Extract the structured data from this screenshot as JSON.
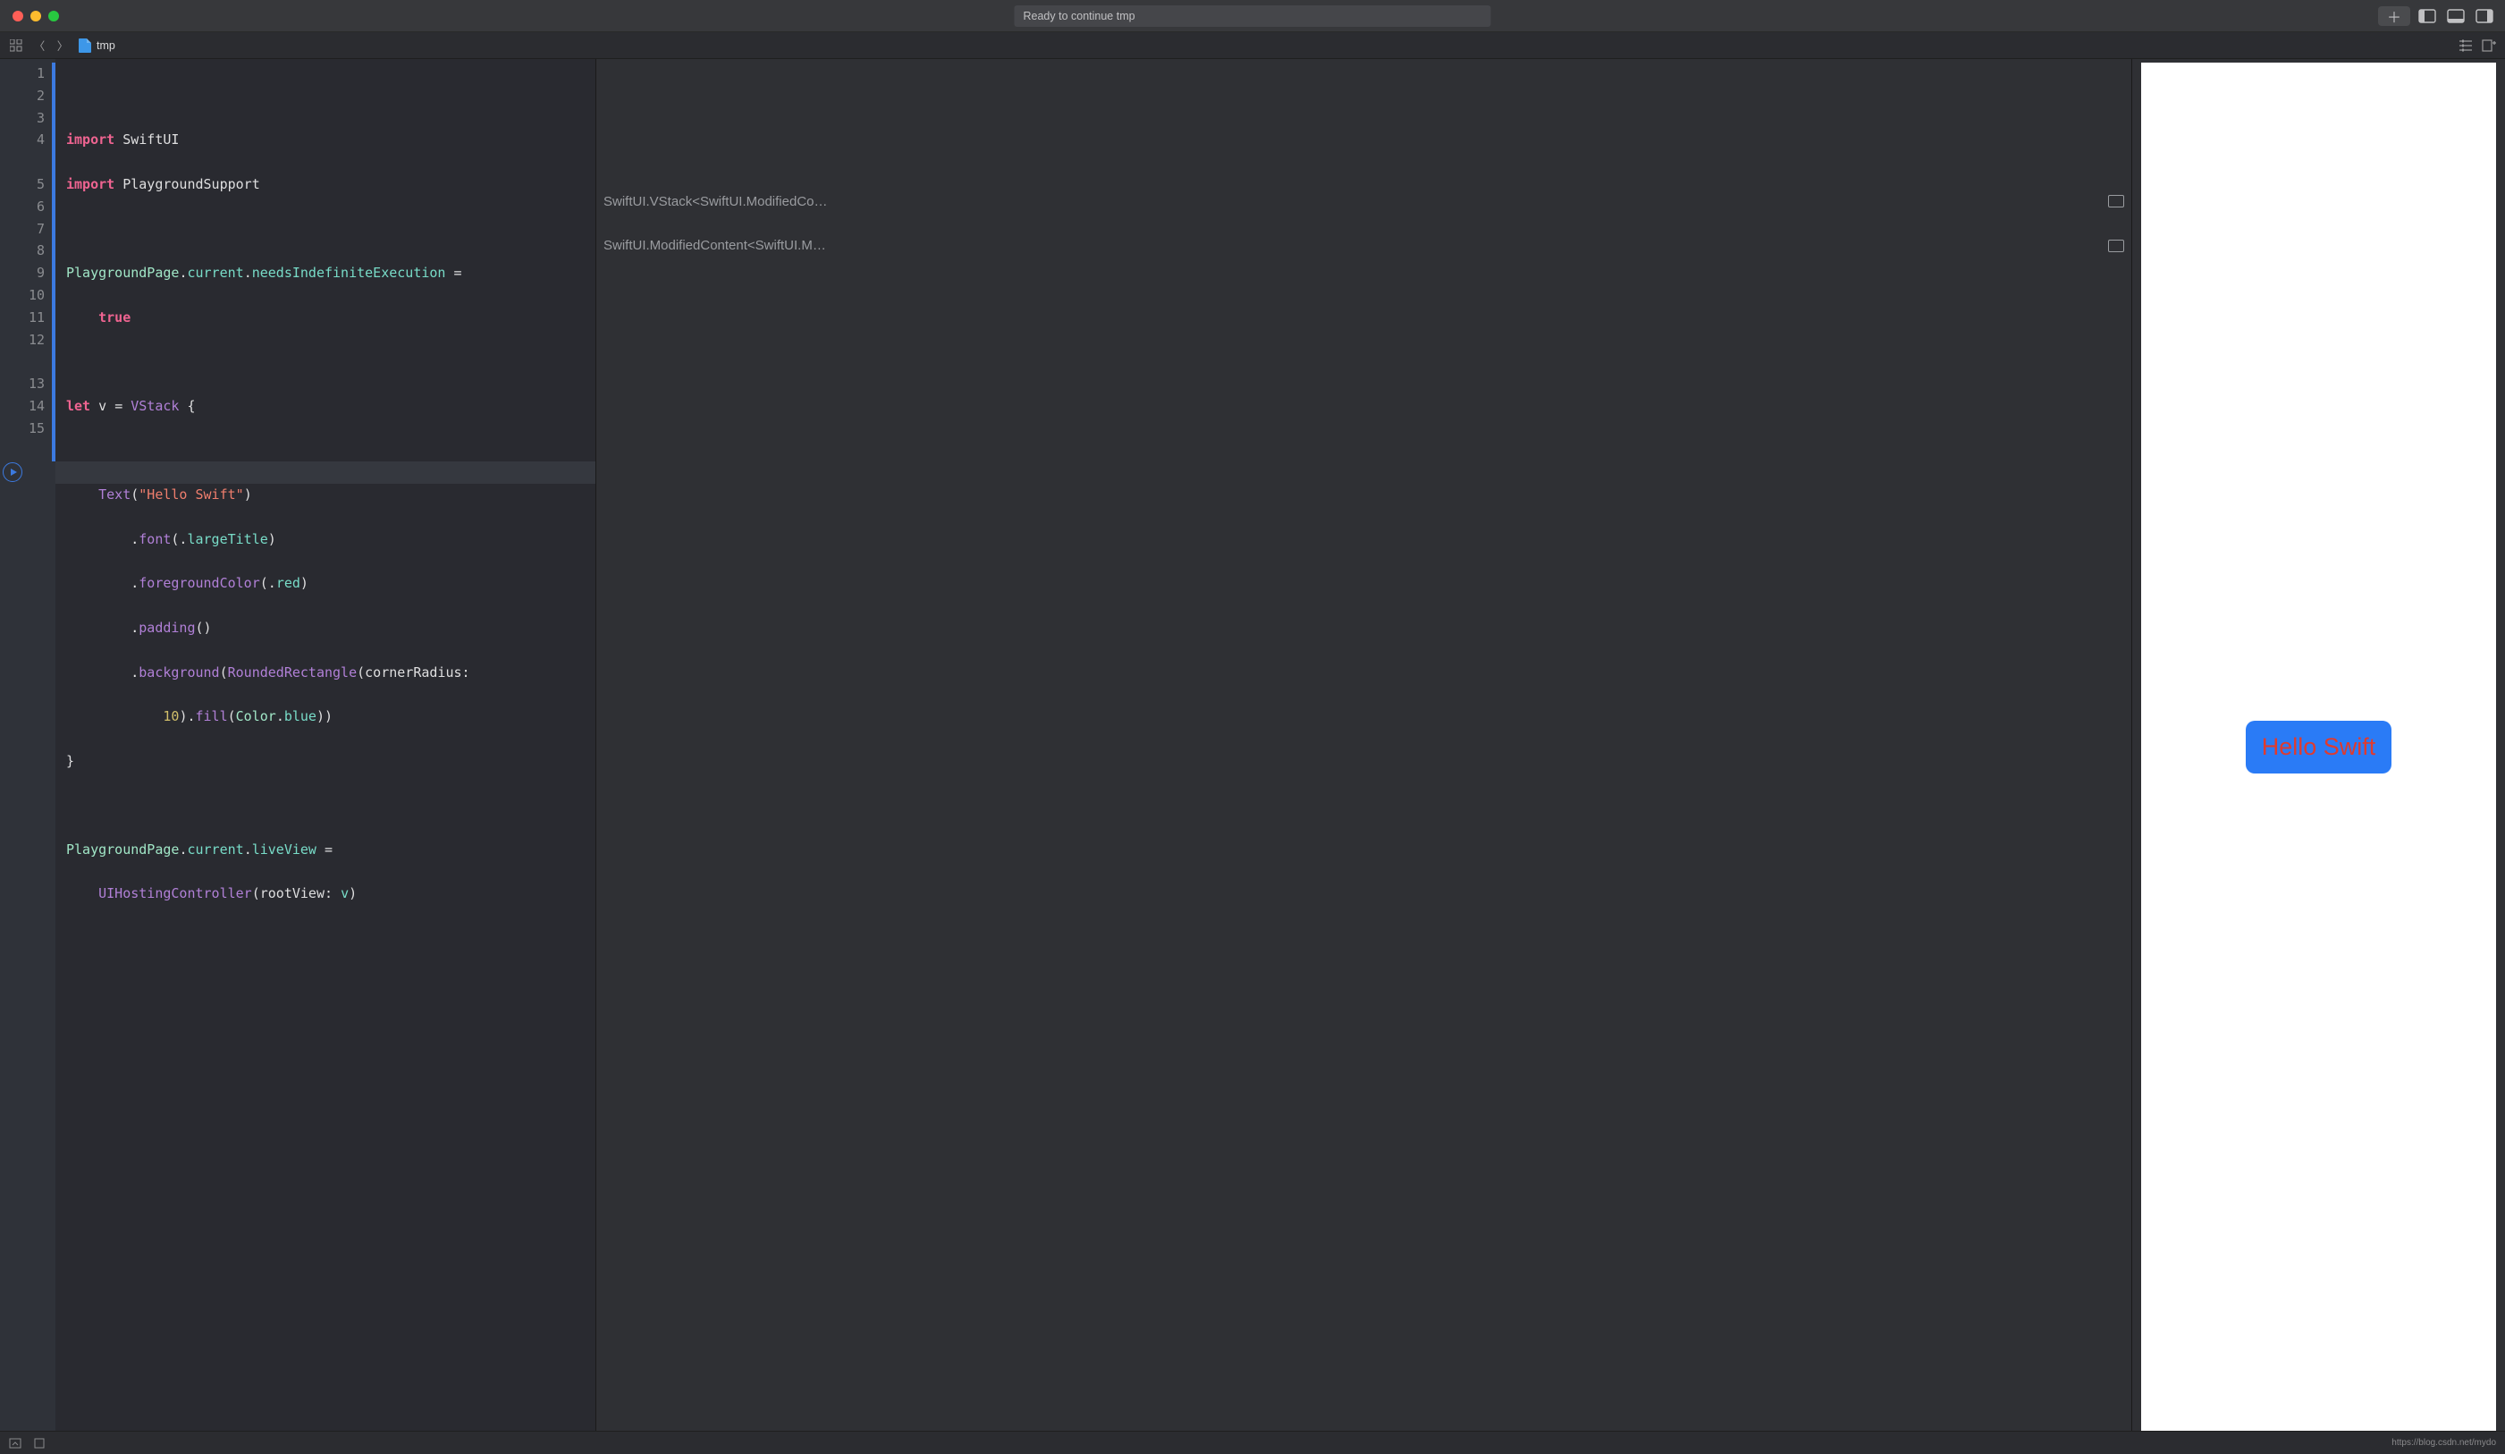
{
  "titlebar": {
    "status": "Ready to continue tmp"
  },
  "nav": {
    "file": "tmp"
  },
  "gutter": [
    "1",
    "2",
    "3",
    "4",
    "",
    "5",
    "6",
    "7",
    "8",
    "9",
    "10",
    "11",
    "12",
    "",
    "13",
    "14",
    "15",
    ""
  ],
  "code": {
    "l1": {
      "import": "import",
      "mod": "SwiftUI"
    },
    "l2": {
      "import": "import",
      "mod": "PlaygroundSupport"
    },
    "l4a": {
      "cls": "PlaygroundPage",
      "dot1": ".",
      "m1": "current",
      "dot2": ".",
      "m2": "needsIndefiniteExecution",
      "eq": " = "
    },
    "l4b": {
      "true": "true"
    },
    "l6": {
      "let": "let",
      "v": " v ",
      "eq": "= ",
      "vstack": "VStack",
      "brace": " {"
    },
    "l8": {
      "text": "Text",
      "open": "(",
      "str": "\"Hello Swift\"",
      "close": ")"
    },
    "l9": {
      "fn": "font",
      "open": "(.",
      "arg": "largeTitle",
      "close": ")"
    },
    "l10": {
      "fn": "foregroundColor",
      "open": "(.",
      "arg": "red",
      "close": ")"
    },
    "l11": {
      "fn": "padding",
      "paren": "()"
    },
    "l12a": {
      "fn": "background",
      "open": "(",
      "rr": "RoundedRectangle",
      "open2": "(",
      "label": "cornerRadius",
      "colon": ": "
    },
    "l12b": {
      "num": "10",
      "close1": ").",
      "fill": "fill",
      "open": "(",
      "colr": "Color",
      "dot": ".",
      "blue": "blue",
      "close2": "))"
    },
    "l13": {
      "brace": "}"
    },
    "l15a": {
      "cls": "PlaygroundPage",
      "dot1": ".",
      "m1": "current",
      "dot2": ".",
      "m2": "liveView",
      "eq": " = "
    },
    "l15b": {
      "host": "UIHostingController",
      "open": "(",
      "label": "rootView",
      "colon": ": ",
      "v": "v",
      "close": ")"
    }
  },
  "results": [
    {
      "text": "SwiftUI.VStack<SwiftUI.ModifiedCo…"
    },
    {
      "text": "SwiftUI.ModifiedContent<SwiftUI.M…"
    }
  ],
  "preview": {
    "label": "Hello Swift"
  },
  "status": {
    "watermark": "https://blog.csdn.net/mydo"
  }
}
